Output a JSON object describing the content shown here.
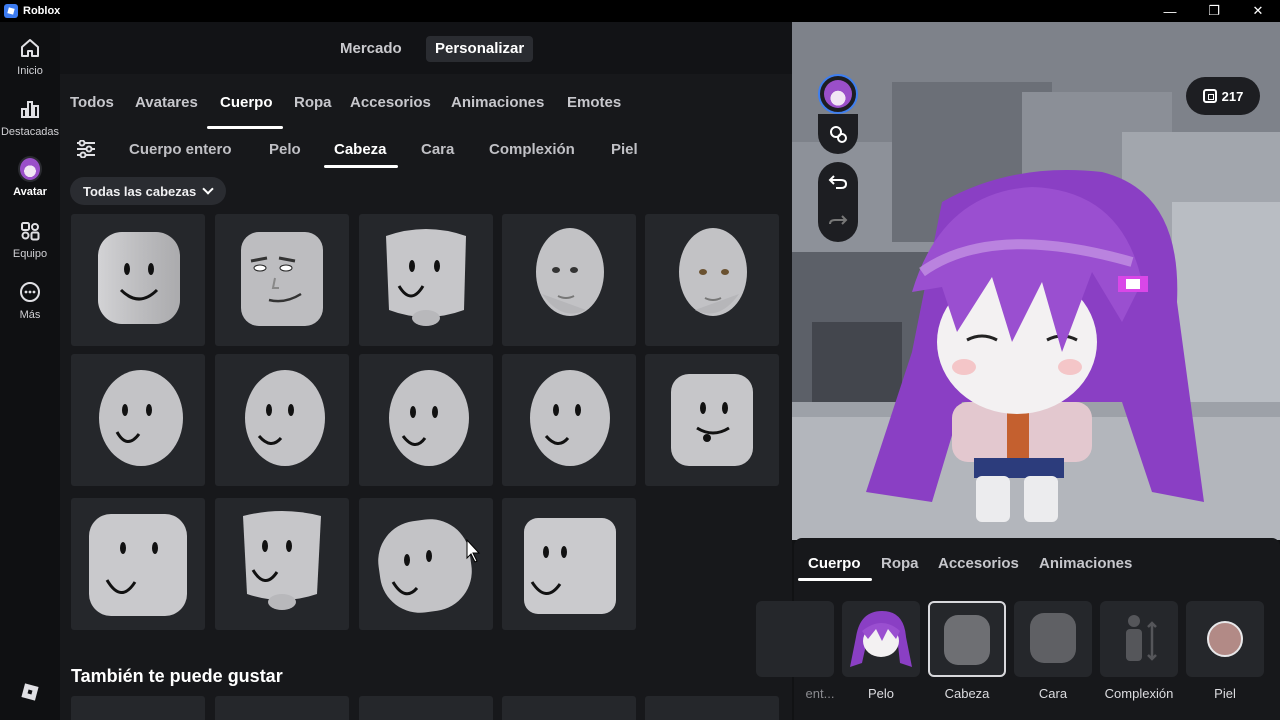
{
  "window": {
    "title": "Roblox",
    "minimize": "—",
    "maximize": "❐",
    "close": "✕"
  },
  "leftnav": {
    "items": [
      {
        "label": "Inicio",
        "icon": "home-icon"
      },
      {
        "label": "Destacadas",
        "icon": "chart-icon"
      },
      {
        "label": "Avatar",
        "icon": "avatar-icon"
      },
      {
        "label": "Equipo",
        "icon": "team-icon"
      },
      {
        "label": "Más",
        "icon": "more-icon"
      }
    ],
    "logo": "roblox-logo"
  },
  "header": {
    "tabs": [
      "Mercado",
      "Personalizar"
    ],
    "active": "Personalizar"
  },
  "catalog": {
    "tabs": [
      "Todos",
      "Avatares",
      "Cuerpo",
      "Ropa",
      "Accesorios",
      "Animaciones",
      "Emotes"
    ],
    "active_tab": "Cuerpo",
    "subtabs": [
      "Cuerpo entero",
      "Pelo",
      "Cabeza",
      "Cara",
      "Complexión",
      "Piel"
    ],
    "active_subtab": "Cabeza",
    "filter": "Todas las cabezas",
    "section_title": "También te puede gustar"
  },
  "viewport": {
    "robux": "217"
  },
  "bottom_panel": {
    "tabs": [
      "Cuerpo",
      "Ropa",
      "Accesorios",
      "Animaciones"
    ],
    "active_tab": "Cuerpo",
    "slots": [
      "ent...",
      "Pelo",
      "Cabeza",
      "Cara",
      "Complexión",
      "Piel"
    ],
    "selected_slot": "Cabeza"
  },
  "colors": {
    "accent": "#ffffff",
    "panel": "#17181b",
    "tile": "#25272b",
    "hair": "#9a4fc9",
    "skin_swatch": "#b28a86"
  }
}
